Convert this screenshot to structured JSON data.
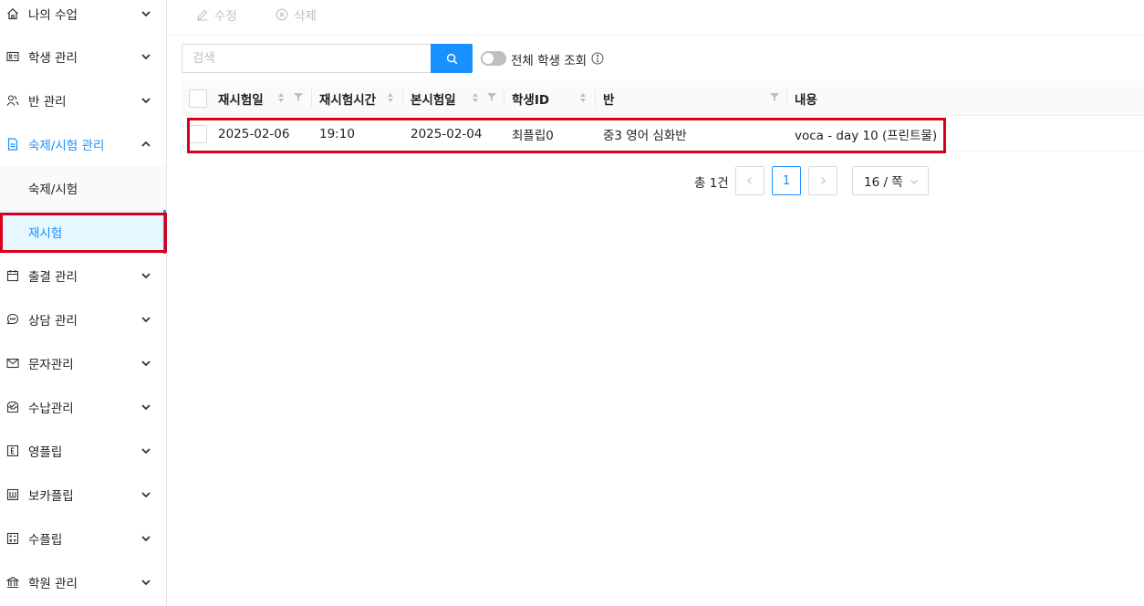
{
  "sidebar": {
    "items": [
      {
        "label": "나의 수업",
        "icon": "home-icon"
      },
      {
        "label": "학생 관리",
        "icon": "id-card-icon"
      },
      {
        "label": "반 관리",
        "icon": "users-icon"
      },
      {
        "label": "숙제/시험 관리",
        "icon": "document-icon"
      },
      {
        "label": "출결 관리",
        "icon": "calendar-icon"
      },
      {
        "label": "상담 관리",
        "icon": "chat-icon"
      },
      {
        "label": "문자관리",
        "icon": "mail-icon"
      },
      {
        "label": "수납관리",
        "icon": "payment-icon"
      },
      {
        "label": "영플립",
        "icon": "e-box-icon"
      },
      {
        "label": "보카플립",
        "icon": "w-box-icon"
      },
      {
        "label": "수플립",
        "icon": "calculator-icon"
      },
      {
        "label": "학원 관리",
        "icon": "bank-icon"
      }
    ],
    "subitems": [
      {
        "label": "숙제/시험"
      },
      {
        "label": "재시험"
      }
    ]
  },
  "toolbar": {
    "edit_label": "수정",
    "delete_label": "삭제"
  },
  "search": {
    "placeholder": "검색",
    "toggle_label": "전체 학생 조회"
  },
  "table": {
    "headers": [
      "재시험일",
      "재시험시간",
      "본시험일",
      "학생ID",
      "반",
      "내용"
    ],
    "rows": [
      [
        "2025-02-06",
        "19:10",
        "2025-02-04",
        "최플립0",
        "중3 영어 심화반",
        "voca - day 10 (프린트물)"
      ]
    ]
  },
  "pagination": {
    "total": "총 1건",
    "current_page": "1",
    "page_size": "16 / 쪽"
  },
  "colors": {
    "accent": "#1890ff",
    "highlight": "#d9001b"
  }
}
